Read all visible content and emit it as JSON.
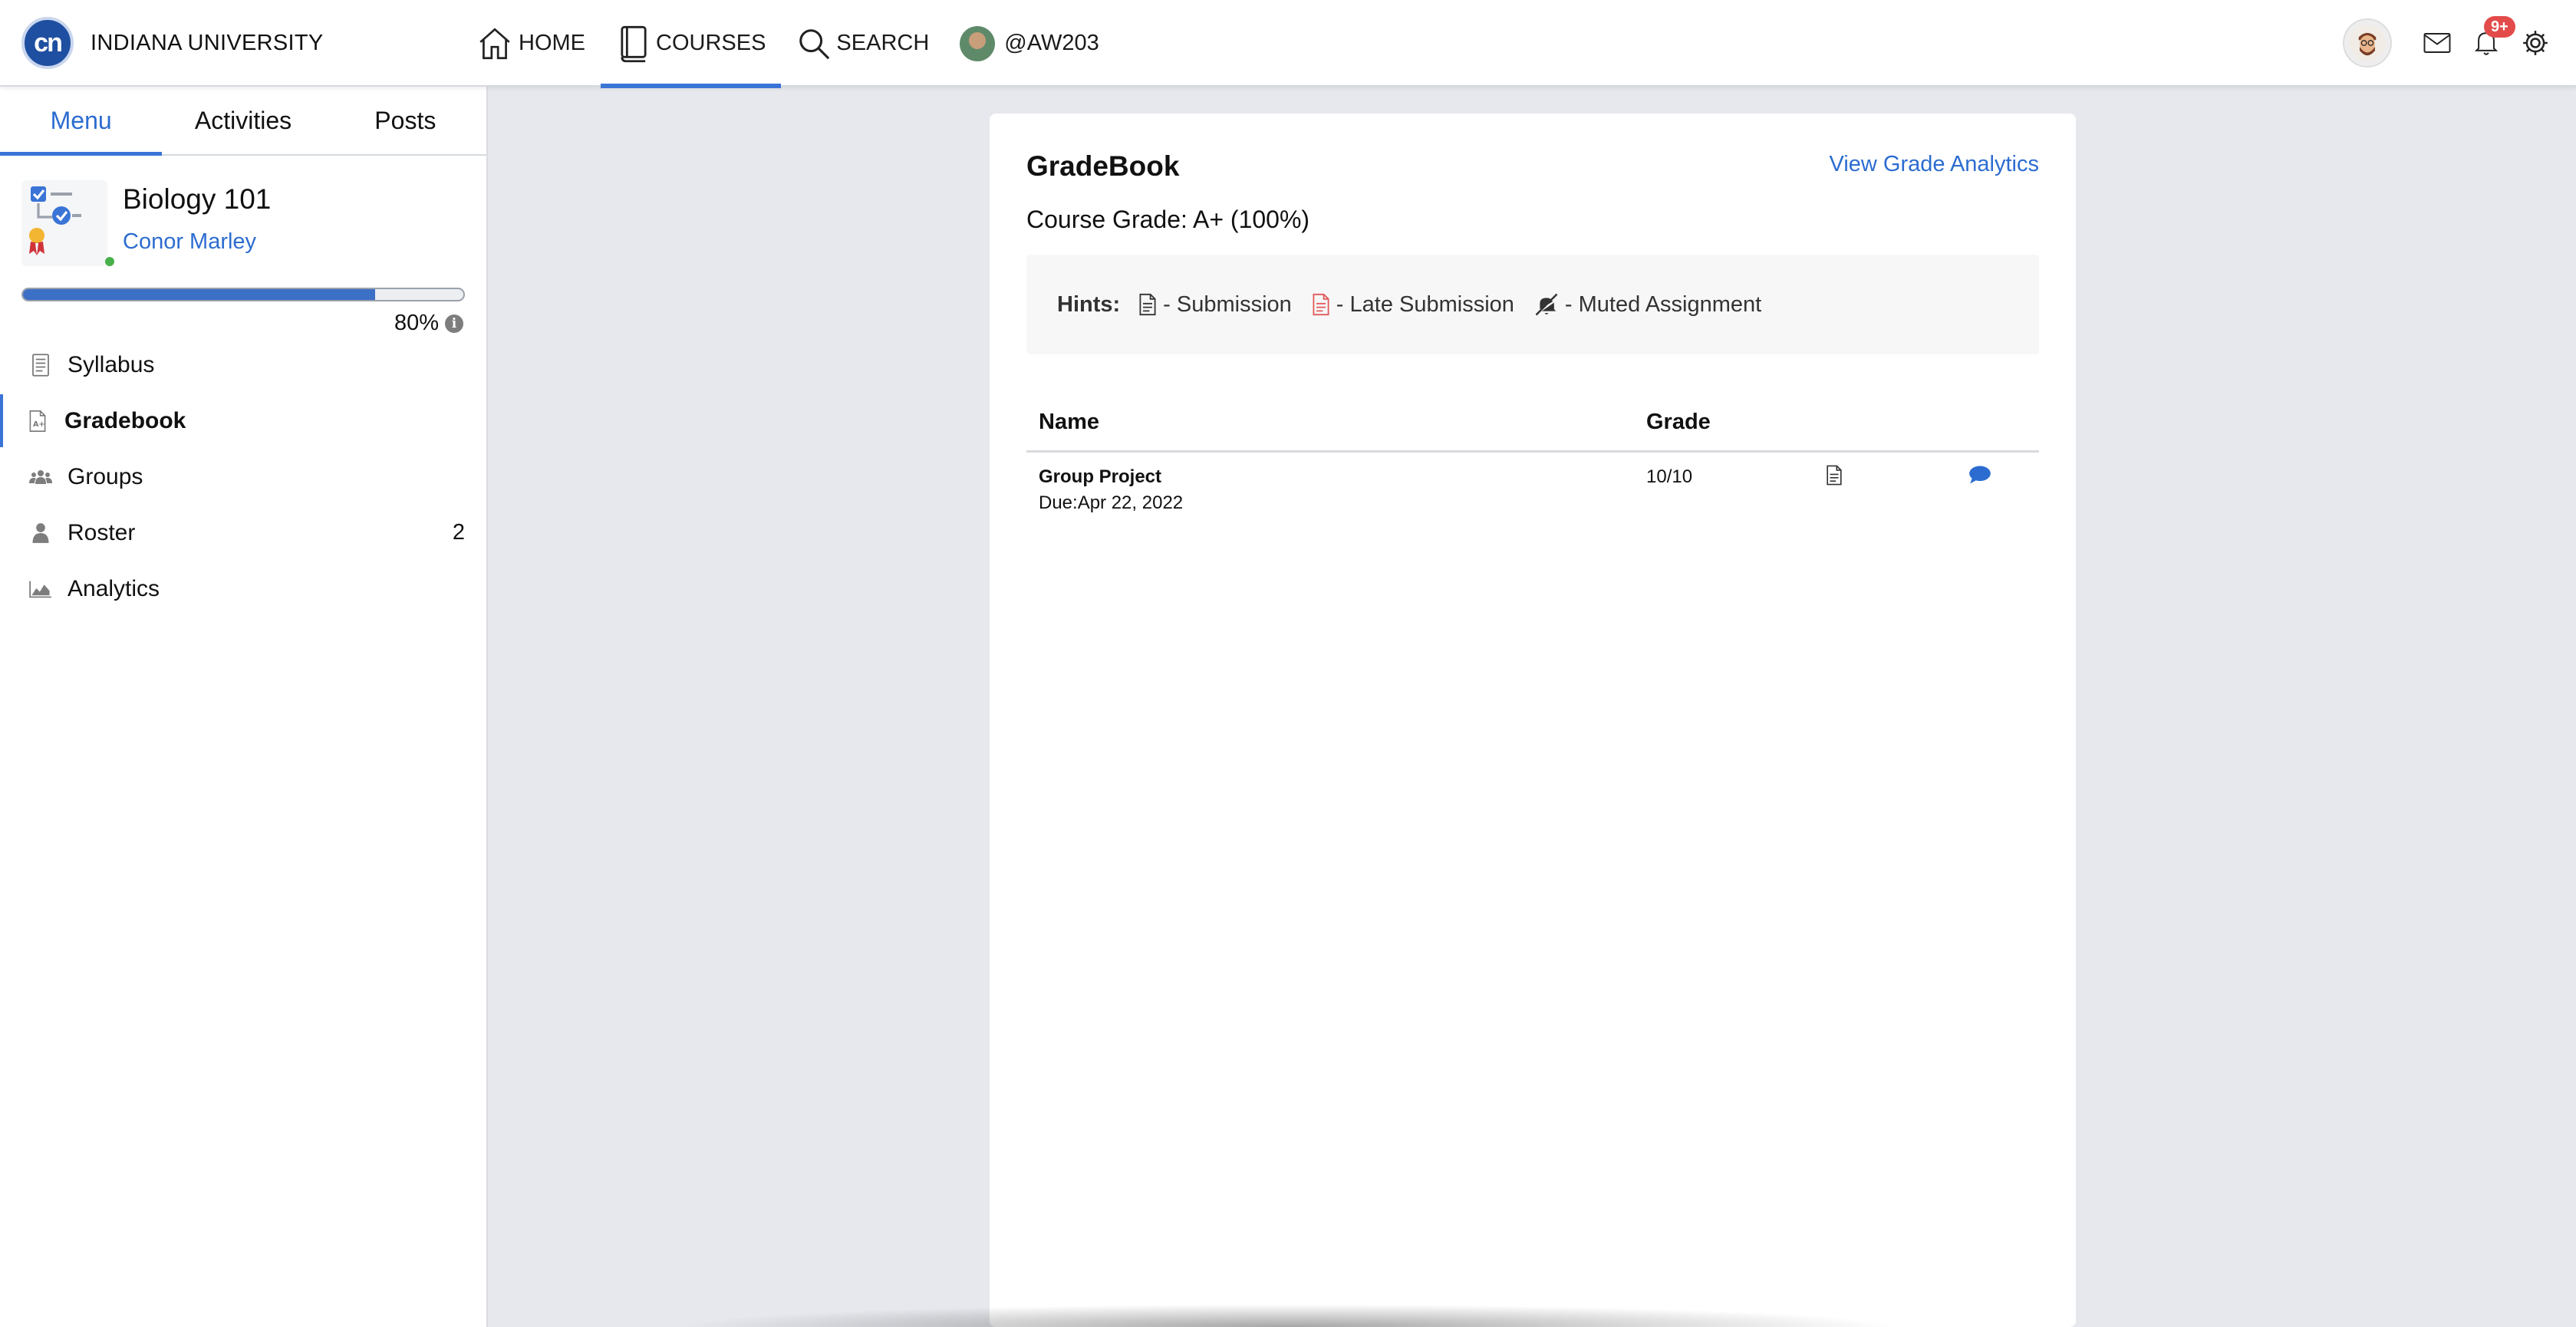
{
  "brand": {
    "logo_text": "cn",
    "name": "INDIANA UNIVERSITY"
  },
  "nav": {
    "items": [
      {
        "label": "HOME",
        "icon": "home-icon"
      },
      {
        "label": "COURSES",
        "icon": "book-icon",
        "active": true
      },
      {
        "label": "SEARCH",
        "icon": "search-icon"
      },
      {
        "label": "@AW203",
        "icon": "avatar"
      }
    ]
  },
  "toolbar": {
    "notification_badge": "9+",
    "icons": [
      "user-avatar",
      "mail-icon",
      "bell-icon",
      "gear-icon"
    ]
  },
  "sidebar": {
    "tabs": [
      {
        "label": "Menu",
        "active": true
      },
      {
        "label": "Activities"
      },
      {
        "label": "Posts"
      }
    ],
    "course": {
      "title": "Biology 101",
      "instructor": "Conor Marley",
      "progress_percent": 80,
      "progress_label": "80%"
    },
    "items": [
      {
        "label": "Syllabus",
        "icon": "syllabus-icon"
      },
      {
        "label": "Gradebook",
        "icon": "gradebook-icon",
        "active": true
      },
      {
        "label": "Groups",
        "icon": "groups-icon"
      },
      {
        "label": "Roster",
        "icon": "person-icon",
        "count": "2"
      },
      {
        "label": "Analytics",
        "icon": "chart-icon"
      }
    ]
  },
  "gradebook": {
    "title": "GradeBook",
    "analytics_link": "View Grade Analytics",
    "course_grade": "Course Grade: A+ (100%)",
    "hints": {
      "label": "Hints:",
      "submission": "- Submission",
      "late_submission": "- Late Submission",
      "muted": "- Muted Assignment"
    },
    "columns": {
      "name": "Name",
      "grade": "Grade"
    },
    "rows": [
      {
        "name": "Group Project",
        "due": "Due:Apr 22, 2022",
        "grade": "10/10"
      }
    ]
  },
  "colors": {
    "accent": "#3a74d6",
    "link": "#2c6cd0",
    "late": "#e05a5a",
    "badge": "#e34b4b",
    "online": "#48b04a"
  }
}
